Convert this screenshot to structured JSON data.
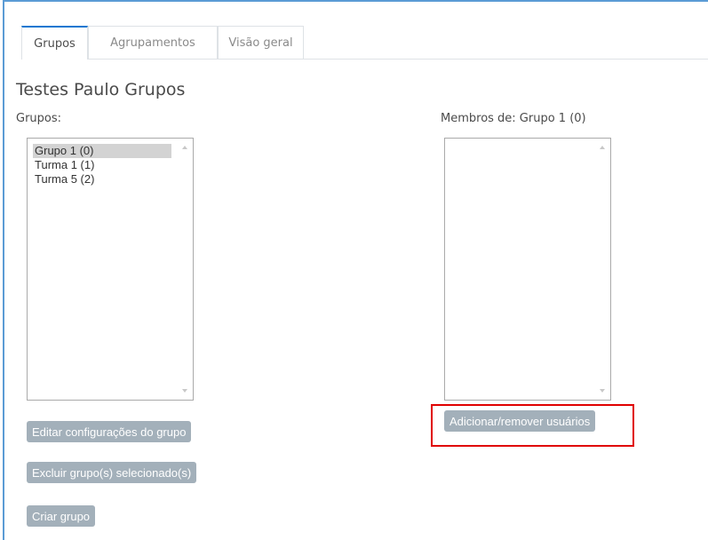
{
  "tabs": [
    {
      "label": "Grupos",
      "active": true
    },
    {
      "label": "Agrupamentos",
      "active": false
    },
    {
      "label": "Visão geral",
      "active": false
    }
  ],
  "page_title": "Testes Paulo Grupos",
  "groups_panel": {
    "label": "Grupos:",
    "options": [
      {
        "label": "Grupo 1 (0)",
        "selected": true
      },
      {
        "label": "Turma 1 (1)",
        "selected": false
      },
      {
        "label": "Turma 5 (2)",
        "selected": false
      }
    ]
  },
  "members_panel": {
    "label": "Membros de: Grupo 1 (0)",
    "options": []
  },
  "buttons": {
    "edit_group": "Editar configurações do grupo",
    "delete_groups": "Excluir grupo(s) selecionado(s)",
    "create_group": "Criar grupo",
    "add_remove_users": "Adicionar/remover usuários"
  },
  "colors": {
    "accent_border": "#5b9bd5",
    "active_tab_top": "#1177d1",
    "button_bg": "#a3b0ba",
    "highlight_box": "#e00000"
  }
}
